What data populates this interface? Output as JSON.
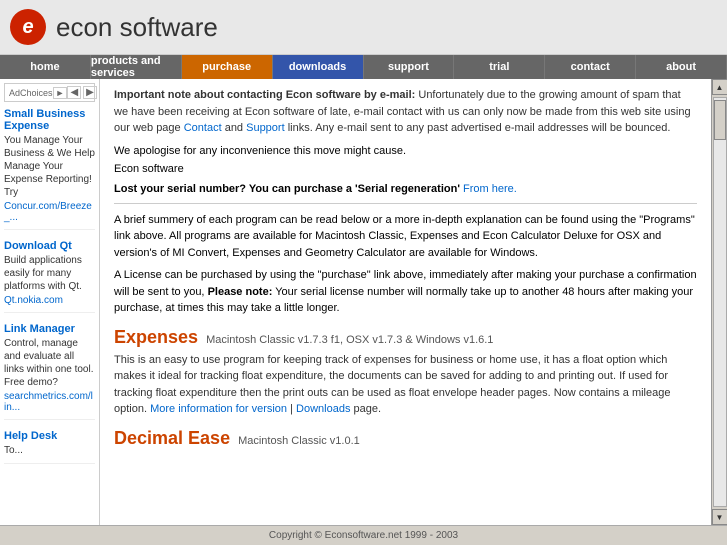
{
  "header": {
    "logo_letter": "e",
    "title": "econ software"
  },
  "nav": {
    "items": [
      {
        "label": "home",
        "class": ""
      },
      {
        "label": "products and services",
        "class": ""
      },
      {
        "label": "purchase",
        "class": "orange"
      },
      {
        "label": "downloads",
        "class": "blue"
      },
      {
        "label": "support",
        "class": ""
      },
      {
        "label": "trial",
        "class": ""
      },
      {
        "label": "contact",
        "class": ""
      },
      {
        "label": "about",
        "class": ""
      }
    ]
  },
  "sidebar": {
    "ad_choices_label": "AdChoices",
    "ads": [
      {
        "title": "Small Business Expense",
        "text": "You Manage Your Business & We Help Manage Your Expense Reporting! Try",
        "link": "Concur.com/Breeze_..."
      },
      {
        "title": "Download Qt",
        "text": "Build applications easily for many platforms with Qt.",
        "link": "Qt.nokia.com"
      },
      {
        "title": "Link Manager",
        "text": "Control, manage and evaluate all links within one tool. Free demo?",
        "link": "searchmetrics.com/lin..."
      },
      {
        "title": "Help Desk",
        "text": "To...",
        "link": ""
      }
    ]
  },
  "content": {
    "important_note_bold": "Important note about contacting Econ software by e-mail:",
    "important_note_text": " Unfortunately due to the growing amount of spam that we have been receiving at Econ software of late, e-mail contact with us can only now be made from this web site using our web page ",
    "contact_link": "Contact",
    "and_text": " and ",
    "support_link": "Support",
    "important_note_end": " links. Any e-mail sent to any past advertised e-mail addresses will be bounced.",
    "apology": "We apologise for any inconvenience this move might cause.",
    "sig": "Econ software",
    "serial_text": "Lost your serial number? You can purchase a 'Serial regeneration' ",
    "serial_link": "From here.",
    "brief_summary": "A brief summery of each program can be read below or a more in-depth explanation can be found using the \"Programs\" link above. All programs are available for Macintosh Classic, Expenses and Econ Calculator Deluxe for OSX and version's of MI Convert, Expenses and Geometry Calculator are available for Windows.",
    "purchase_note": "A License can be purchased by using the \"purchase\" link above, immediately after making your purchase a confirmation will be sent to you, ",
    "purchase_note_bold": "Please note:",
    "purchase_note_end": " Your serial license number will normally take up to another 48 hours after making your purchase, at times this may take a little longer.",
    "products": [
      {
        "title": "Expenses",
        "subtitle": "Macintosh Classic v1.7.3 f1, OSX v1.7.3 & Windows v1.6.1",
        "desc": "This is an easy to use program for keeping track of expenses for business or home use, it has a float option which makes it ideal for tracking float expenditure, the documents can be saved for adding to and printing out. If used for tracking float expenditure then the print outs can be used as float envelope header pages. Now contains a mileage option. ",
        "link1": "More information for version",
        "separator": " | ",
        "link2": "Downloads",
        "desc_end": " page."
      },
      {
        "title": "Decimal Ease",
        "subtitle": "Macintosh Classic v1.0.1",
        "desc": "",
        "link1": "",
        "separator": "",
        "link2": "",
        "desc_end": ""
      }
    ]
  },
  "footer": {
    "text": "Copyright © Econsoftware.net 1999 - 2003"
  }
}
